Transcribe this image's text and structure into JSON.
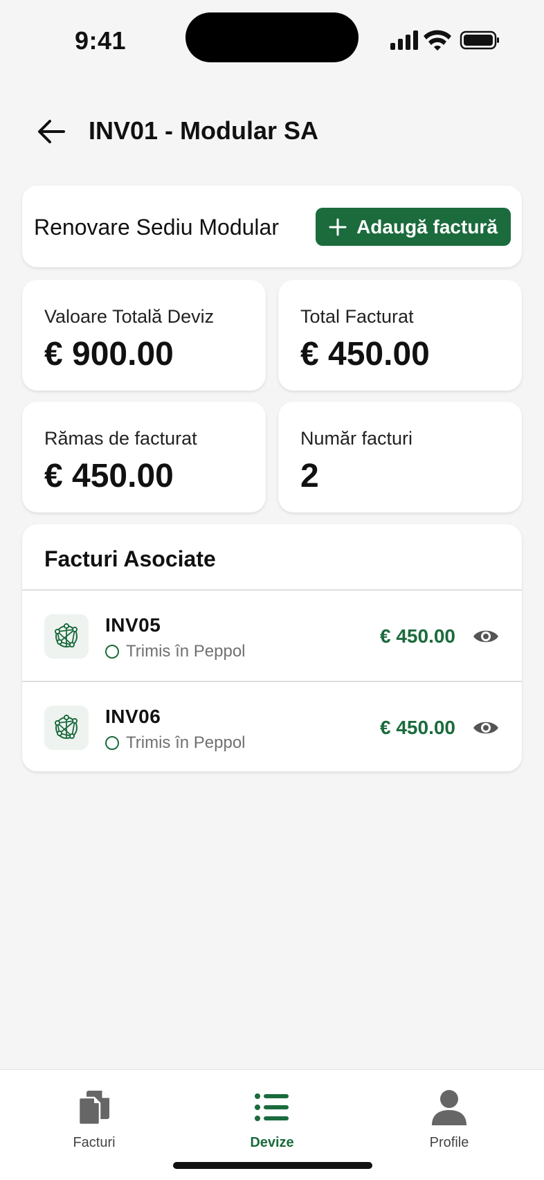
{
  "status_bar": {
    "time": "9:41"
  },
  "header": {
    "title": "INV01 - Modular SA",
    "back_icon": "arrow-left-icon"
  },
  "project": {
    "name": "Renovare Sediu Modular",
    "add_button_label": "Adaugă factură",
    "add_icon": "plus-icon"
  },
  "stats": [
    {
      "label": "Valoare Totală Deviz",
      "value": "€ 900.00"
    },
    {
      "label": "Total Facturat",
      "value": "€ 450.00"
    },
    {
      "label": "Rămas de facturat",
      "value": "€ 450.00"
    },
    {
      "label": "Număr facturi",
      "value": "2"
    }
  ],
  "invoices": {
    "title": "Facturi Asociate",
    "items": [
      {
        "number": "INV05",
        "status": "Trimis în Peppol",
        "amount": "€ 450.00"
      },
      {
        "number": "INV06",
        "status": "Trimis în Peppol",
        "amount": "€ 450.00"
      }
    ]
  },
  "tab_bar": {
    "items": [
      {
        "label": "Facturi",
        "icon": "documents-icon",
        "active": false
      },
      {
        "label": "Devize",
        "icon": "list-icon",
        "active": true
      },
      {
        "label": "Profile",
        "icon": "person-icon",
        "active": false
      }
    ]
  },
  "colors": {
    "accent": "#1b6b3d",
    "background": "#f5f5f5",
    "card": "#ffffff",
    "muted_text": "#707070",
    "icon_gray": "#555555"
  }
}
